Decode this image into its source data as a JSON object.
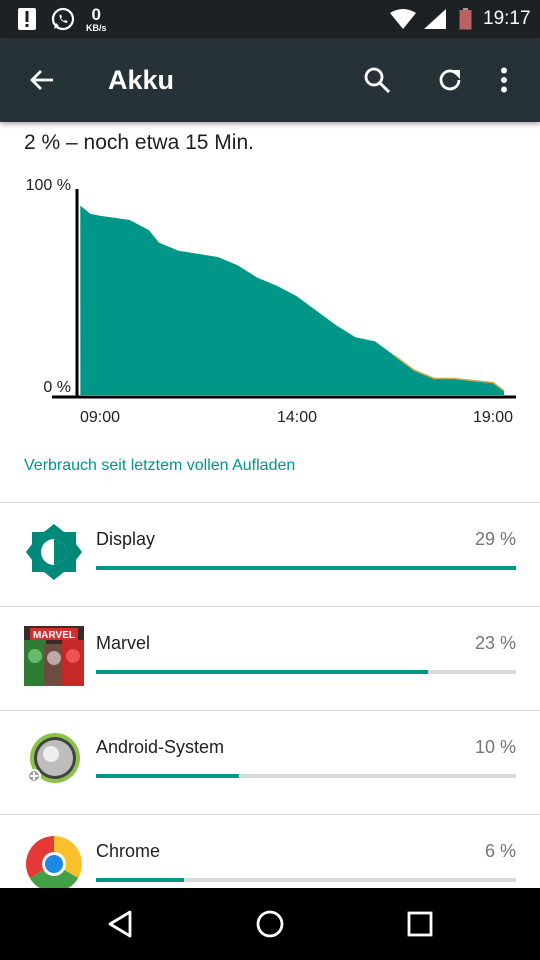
{
  "status_bar": {
    "data_rate_value": "0",
    "data_rate_unit": "KB/s",
    "time": "19:17",
    "icons": [
      "alert-icon",
      "whatsapp-icon",
      "wifi-icon",
      "signal-icon",
      "battery-low-icon"
    ]
  },
  "app_bar": {
    "title": "Akku",
    "icons": [
      "back-arrow-icon",
      "search-icon",
      "refresh-icon",
      "more-vert-icon"
    ]
  },
  "summary": "2 % – noch etwa 15 Min.",
  "chart_data": {
    "type": "area",
    "y_labels": [
      "100 %",
      "0 %"
    ],
    "x_labels": [
      "09:00",
      "14:00",
      "19:00"
    ],
    "ylim": [
      0,
      100
    ],
    "xlim": [
      "08:30",
      "19:17"
    ],
    "series": [
      {
        "x": [
          "08:30",
          "08:45",
          "09:00",
          "09:45",
          "10:15",
          "10:30",
          "11:00",
          "12:00",
          "12:30",
          "13:00",
          "13:30",
          "14:00",
          "14:30",
          "15:00",
          "15:30",
          "16:00",
          "16:30",
          "17:00",
          "17:30",
          "18:00",
          "18:30",
          "19:00",
          "19:17"
        ],
        "values": [
          92,
          88,
          87,
          85,
          80,
          74,
          70,
          67,
          63,
          57,
          53,
          48,
          41,
          34,
          28,
          26,
          19,
          12,
          8,
          8,
          7,
          6,
          2
        ]
      }
    ],
    "colors": {
      "fill": "#009688",
      "axis": "#000000"
    }
  },
  "section_link": "Verbrauch seit letztem vollen Aufladen",
  "apps": [
    {
      "name": "Display",
      "percent_label": "29 %",
      "bar_fraction": 1.0,
      "icon": "brightness-icon"
    },
    {
      "name": "Marvel",
      "percent_label": "23 %",
      "bar_fraction": 0.79,
      "icon": "marvel-app-icon"
    },
    {
      "name": "Android-System",
      "percent_label": "10 %",
      "bar_fraction": 0.34,
      "icon": "android-system-icon"
    },
    {
      "name": "Chrome",
      "percent_label": "6 %",
      "bar_fraction": 0.21,
      "icon": "chrome-icon"
    }
  ],
  "nav_bar": {
    "icons": [
      "nav-back-icon",
      "nav-home-icon",
      "nav-recents-icon"
    ]
  },
  "colors": {
    "accent": "#009688",
    "app_bar": "#263238",
    "status_bar": "#1c2124"
  }
}
